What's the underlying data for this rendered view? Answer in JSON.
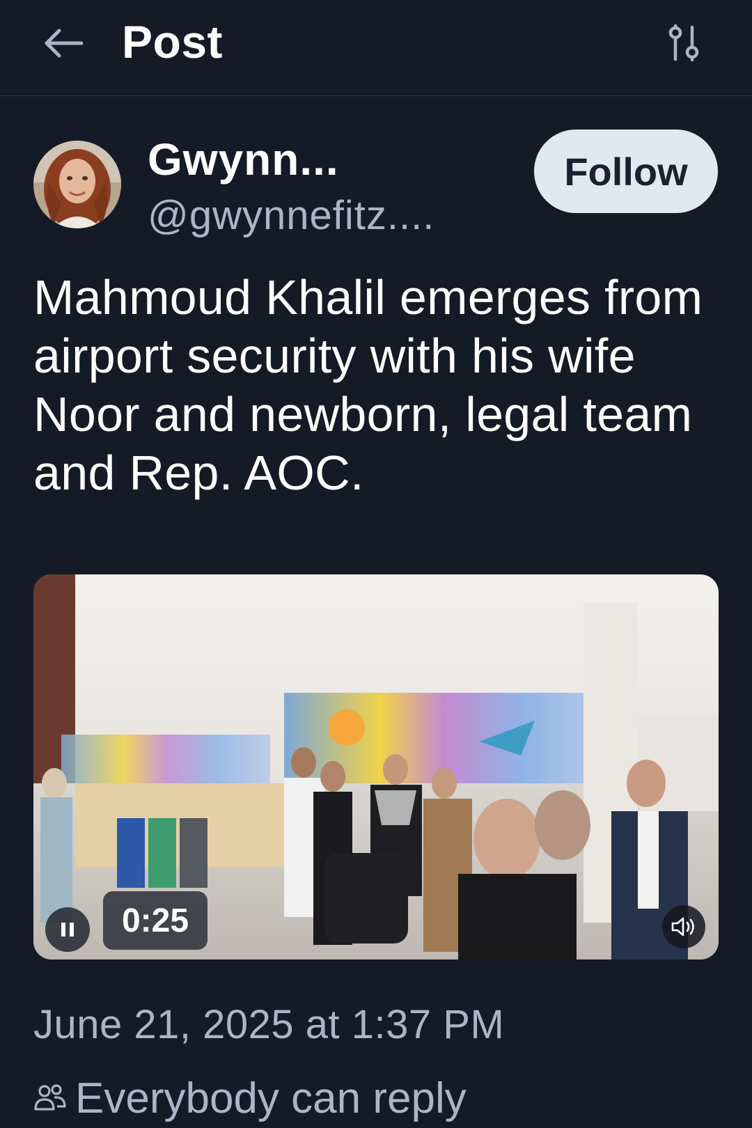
{
  "header": {
    "title": "Post",
    "back_icon": "arrow-left-icon",
    "filter_icon": "sliders-icon"
  },
  "author": {
    "display_name": "Gwynn...",
    "handle": "@gwynnefitz....",
    "follow_label": "Follow"
  },
  "post": {
    "text": "Mahmoud Khalil emerges from airport security with his wife Noor and newborn, legal team and Rep. AOC."
  },
  "video": {
    "time_remaining": "0:25",
    "pause_icon": "pause-icon",
    "volume_icon": "volume-icon"
  },
  "meta": {
    "timestamp": "June 21, 2025 at 1:37 PM",
    "reply_setting": "Everybody can reply",
    "reply_icon": "people-icon"
  },
  "colors": {
    "background": "#151b26",
    "secondary_text": "#aab6c7",
    "follow_button_bg": "#e2e8f0"
  }
}
